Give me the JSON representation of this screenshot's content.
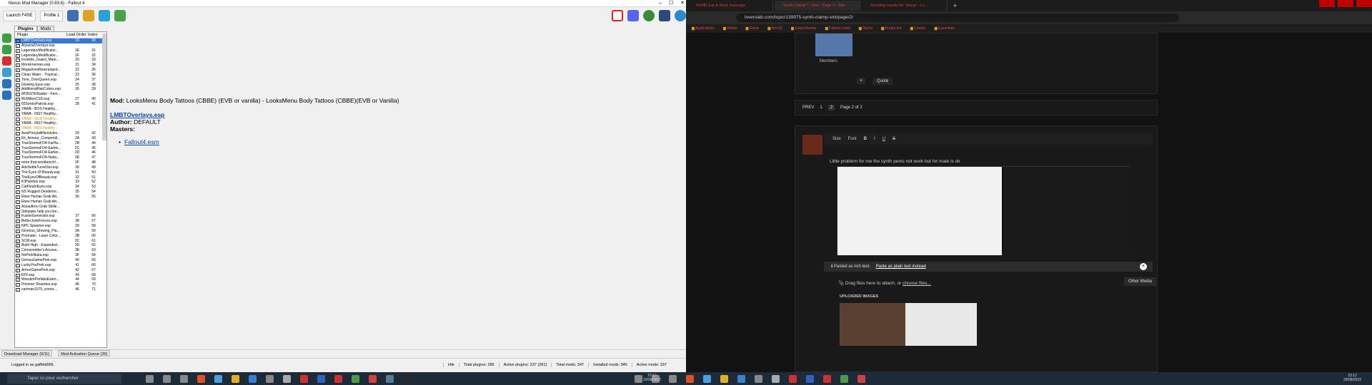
{
  "nmm": {
    "title": "Nexus Mod Manager (0.83.6) - Fallout 4",
    "launch_label": "Launch F4SE",
    "profile_label": "Profile 1",
    "tabs": [
      "Plugins",
      "Mods"
    ],
    "columns": {
      "plugin": "Plugin",
      "load_order": "Load Order",
      "index": "Index"
    },
    "plugins": [
      {
        "name": "LMBTOverlays.esp",
        "lo": "1D",
        "ix": "30",
        "state": "sel"
      },
      {
        "name": "AlyazzaOverlays.esp",
        "lo": "",
        "ix": "",
        "state": ""
      },
      {
        "name": "LegendaryModificatio...",
        "lo": "1E",
        "ix": "31",
        "state": ""
      },
      {
        "name": "LegendaryModificatio...",
        "lo": "1F",
        "ix": "32",
        "state": ""
      },
      {
        "name": "Invisible_Guard_Mark...",
        "lo": "20",
        "ix": "33",
        "state": ""
      },
      {
        "name": "MoreEnemies.esp",
        "lo": "21",
        "ix": "34",
        "state": ""
      },
      {
        "name": "MagazinesRearranged...",
        "lo": "22",
        "ix": "35",
        "state": ""
      },
      {
        "name": "Clean Water - Tropical...",
        "lo": "23",
        "ix": "36",
        "state": ""
      },
      {
        "name": "Tone_OverQueen.esp",
        "lo": "24",
        "ix": "37",
        "state": ""
      },
      {
        "name": "Glowing Eyes.esp",
        "lo": "25",
        "ix": "38",
        "state": ""
      },
      {
        "name": "AdditionalHairColors.esp",
        "lo": "26",
        "ix": "39",
        "state": ""
      },
      {
        "name": "MONSTERaider - Fem...",
        "lo": "",
        "ix": "",
        "state": ""
      },
      {
        "name": "McMillanCSS.esp",
        "lo": "27",
        "ix": "40",
        "state": ""
      },
      {
        "name": "65SeriesPatrols.esp",
        "lo": "28",
        "ix": "41",
        "state": ""
      },
      {
        "name": "YAWA - BOS Healthy...",
        "lo": "",
        "ix": "",
        "state": ""
      },
      {
        "name": "YAWA - INST Healthy...",
        "lo": "",
        "ix": "",
        "state": ""
      },
      {
        "name": "YAWA - GUN Healthy...",
        "lo": "",
        "ix": "",
        "state": "dim"
      },
      {
        "name": "YAWA - INST Healthy...",
        "lo": "",
        "ix": "",
        "state": ""
      },
      {
        "name": "YAWA - BOS Healthy...",
        "lo": "",
        "ix": "",
        "state": "dim"
      },
      {
        "name": "AzarPonytailHairstyles...",
        "lo": "29",
        "ix": "42",
        "state": ""
      },
      {
        "name": "Eli_Armour_Compendi...",
        "lo": "2A",
        "ix": "43",
        "state": ""
      },
      {
        "name": "TrueStormsFO4-FarHa...",
        "lo": "2B",
        "ix": "44",
        "state": ""
      },
      {
        "name": "TrueStormsFO4-Earlier...",
        "lo": "2C",
        "ix": "45",
        "state": ""
      },
      {
        "name": "TrueStormsFO4-Earlier...",
        "lo": "2D",
        "ix": "46",
        "state": ""
      },
      {
        "name": "TrueStormsFO4-Nuka...",
        "lo": "2E",
        "ix": "47",
        "state": ""
      },
      {
        "name": "more that workbench!...",
        "lo": "2F",
        "ix": "48",
        "state": ""
      },
      {
        "name": "AdvSettleTurretSet.esp",
        "lo": "30",
        "ix": "49",
        "state": ""
      },
      {
        "name": "The Eyes Of Beauty.esp",
        "lo": "31",
        "ix": "50",
        "state": ""
      },
      {
        "name": "TheEyesOfBeauty.esp",
        "lo": "32",
        "ix": "51",
        "state": ""
      },
      {
        "name": "K3Hairdos.esp",
        "lo": "33",
        "ix": "52",
        "state": ""
      },
      {
        "name": "CatFleaInEyes.esp",
        "lo": "34",
        "ix": "53",
        "state": ""
      },
      {
        "name": "NS Rugged Desdemo...",
        "lo": "35",
        "ix": "54",
        "state": ""
      },
      {
        "name": "Ebee Human Grab Att...",
        "lo": "36",
        "ix": "55",
        "state": ""
      },
      {
        "name": "Ebee Human Grab Att...",
        "lo": "",
        "ix": "",
        "state": ""
      },
      {
        "name": "Assaultron Grab Skille...",
        "lo": "",
        "ix": "",
        "state": ""
      },
      {
        "name": "Stimpaks help you bre...",
        "lo": "",
        "ix": "",
        "state": ""
      },
      {
        "name": "FusionGenerator.esp",
        "lo": "37",
        "ix": "56",
        "state": ""
      },
      {
        "name": "BetterJunkFences.esp",
        "lo": "38",
        "ix": "57",
        "state": ""
      },
      {
        "name": "NPC Spawner.esp",
        "lo": "39",
        "ix": "58",
        "state": ""
      },
      {
        "name": "Glorious_Glowing_Pla...",
        "lo": "3A",
        "ix": "59",
        "state": ""
      },
      {
        "name": "Prismatic - Laser Color...",
        "lo": "3B",
        "ix": "60",
        "state": ""
      },
      {
        "name": "SCM.esp",
        "lo": "3C",
        "ix": "61",
        "state": ""
      },
      {
        "name": "Build High - Expanded...",
        "lo": "3D",
        "ix": "62",
        "state": ""
      },
      {
        "name": "Crimsonrider's Access...",
        "lo": "3E",
        "ix": "63",
        "state": ""
      },
      {
        "name": "NoPerkNuka.esp",
        "lo": "3F",
        "ix": "64",
        "state": ""
      },
      {
        "name": "GeniusGamePerk.esp",
        "lo": "40",
        "ix": "65",
        "state": ""
      },
      {
        "name": "LuckyYouPerk.esp",
        "lo": "41",
        "ix": "66",
        "state": ""
      },
      {
        "name": "ArmorGamePerk.esp",
        "lo": "42",
        "ix": "67",
        "state": ""
      },
      {
        "name": "EFF.esp",
        "lo": "43",
        "ix": "68",
        "state": ""
      },
      {
        "name": "WoodenPrefabsExten...",
        "lo": "44",
        "ix": "69",
        "state": ""
      },
      {
        "name": "Prisoner Shackles.esp",
        "lo": "45",
        "ix": "70",
        "state": ""
      },
      {
        "name": "cartman1575_scenic...",
        "lo": "46",
        "ix": "71",
        "state": ""
      }
    ],
    "detail": {
      "mod_label": "Mod:",
      "mod_text": "LooksMenu Body Tattoos (CBBE) (EVB or vanilla) - LooksMenu Body Tattoos (CBBE)(EVB or Vanilla)",
      "esp": "LMBTOverlays.esp",
      "author_label": "Author:",
      "author": "DEFAULT",
      "masters_label": "Masters:",
      "master": "Fallout4.esm"
    },
    "bottom_tabs": [
      "Download Manager (0/11)",
      "Mod Activation Queue (25)"
    ],
    "status": {
      "logged": "Logged in as gaffeld666.",
      "idle": "Idle",
      "total_plugins": "Total plugins: 285",
      "active_plugins": "Active plugins:  237 (281)",
      "total_mods": "Total mods: 347",
      "installed_mods": "Installed mods: 345",
      "active_mods": "Active mods: 337"
    }
  },
  "browser": {
    "tabs": [
      "ASMR Ear & Neck massage",
      "Synth Clamp? - Gen - Page 2 - Site...",
      "Showing results for 'clamp' - Lo..."
    ],
    "url": "loverslab.com/topic/139975-synth-clamp-smi/page/2/",
    "bookmarks": [
      "Applications",
      "Webm",
      "Game",
      "Art+3D",
      "Subscribestar",
      "Patreon artist",
      "Skyfor",
      "Al pleu the",
      "Creator",
      "Essentials"
    ],
    "members": "Members",
    "quote": "Quote",
    "plus": "+",
    "pager": {
      "prev": "PREV",
      "p1": "1",
      "p2": "2",
      "of": "Page 2 of 2"
    },
    "editor_tools": {
      "size": "Size",
      "font": "Font"
    },
    "post_text": "Little problem for me the synth penis not work but for male is ok",
    "pasted": "Pasted as rich text.",
    "pasted_link": "Paste as plain text instead",
    "drag": "Drag files here to attach, or",
    "choose": "choose files...",
    "other_media": "Other Media",
    "uploaded": "UPLOADED IMAGES"
  },
  "taskbar": {
    "search": "Taper ici pour rechercher",
    "time1": "23:12",
    "date1": "29/08/2022",
    "time2": "23:12",
    "date2": "29/08/2022"
  }
}
